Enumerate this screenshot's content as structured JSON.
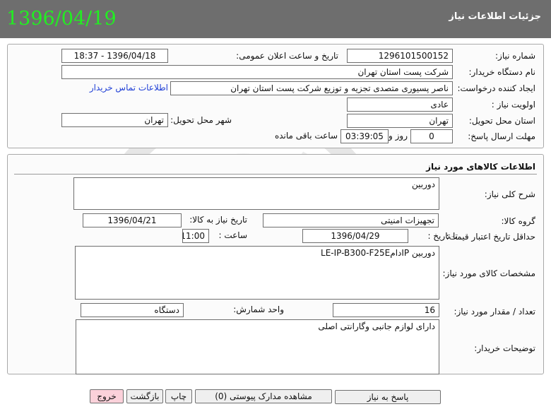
{
  "header": {
    "title": "جزئیات اطلاعات نیاز",
    "date": "1396/04/19"
  },
  "need_info": {
    "need_number_label": "شماره نیاز:",
    "need_number": "1296101500152",
    "announce_label": "تاریخ و ساعت اعلان عمومی:",
    "announce_value": "1396/04/18 - 18:37",
    "buyer_org_label": "نام دستگاه خریدار:",
    "buyer_org": "شرکت پست استان تهران",
    "creator_label": "ایجاد کننده درخواست:",
    "creator": "ناصر پسیوری متصدی تجزیه و توزیع شرکت پست استان تهران",
    "contact_link": "اطلاعات تماس خریدار",
    "priority_label": "اولویت نیاز :",
    "priority": "عادی",
    "province_label": "استان محل تحویل:",
    "province": "تهران",
    "city_label": "شهر محل تحویل:",
    "city": "تهران",
    "deadline_label": "مهلت ارسال پاسخ:",
    "days_value": "0",
    "days_label": "روز و",
    "time_value": "03:39:05",
    "remaining_label": "ساعت باقی مانده"
  },
  "goods": {
    "section_title": "اطلاعات کالاهای مورد نیاز",
    "desc_label": "شرح کلی نیاز:",
    "desc": "دوربین",
    "group_label": "گروه کالا:",
    "group": "تجهیزات امنیتی",
    "need_date_label": "تاریخ نیاز به کالا:",
    "need_date": "1396/04/21",
    "validity_label": "حداقل تاریخ اعتبار قیمت:",
    "until_label": "تا تاریخ :",
    "validity_date": "1396/04/29",
    "time_label": "ساعت :",
    "validity_time": "11:00",
    "spec_label": "مشخصات کالای مورد نیاز:",
    "spec": "دوربین IPدامLE-IP-B300-F25E",
    "qty_label": "تعداد / مقدار مورد نیاز:",
    "qty": "16",
    "unit_label": "واحد شمارش:",
    "unit": "دستگاه",
    "notes_label": "توضیحات خریدار:",
    "notes": "دارای لوازم جانبی وگارانتی اصلی"
  },
  "buttons": {
    "reply": "پاسخ به نیاز",
    "attachments": "مشاهده مدارک پیوستی (0)",
    "print": "چاپ",
    "back": "بازگشت",
    "exit": "خروج"
  },
  "colors": {
    "header_bg": "#6e6e6e",
    "date_green": "#22ee22",
    "link_blue": "#1f3fd6",
    "exit_pink": "#fbd1da"
  }
}
